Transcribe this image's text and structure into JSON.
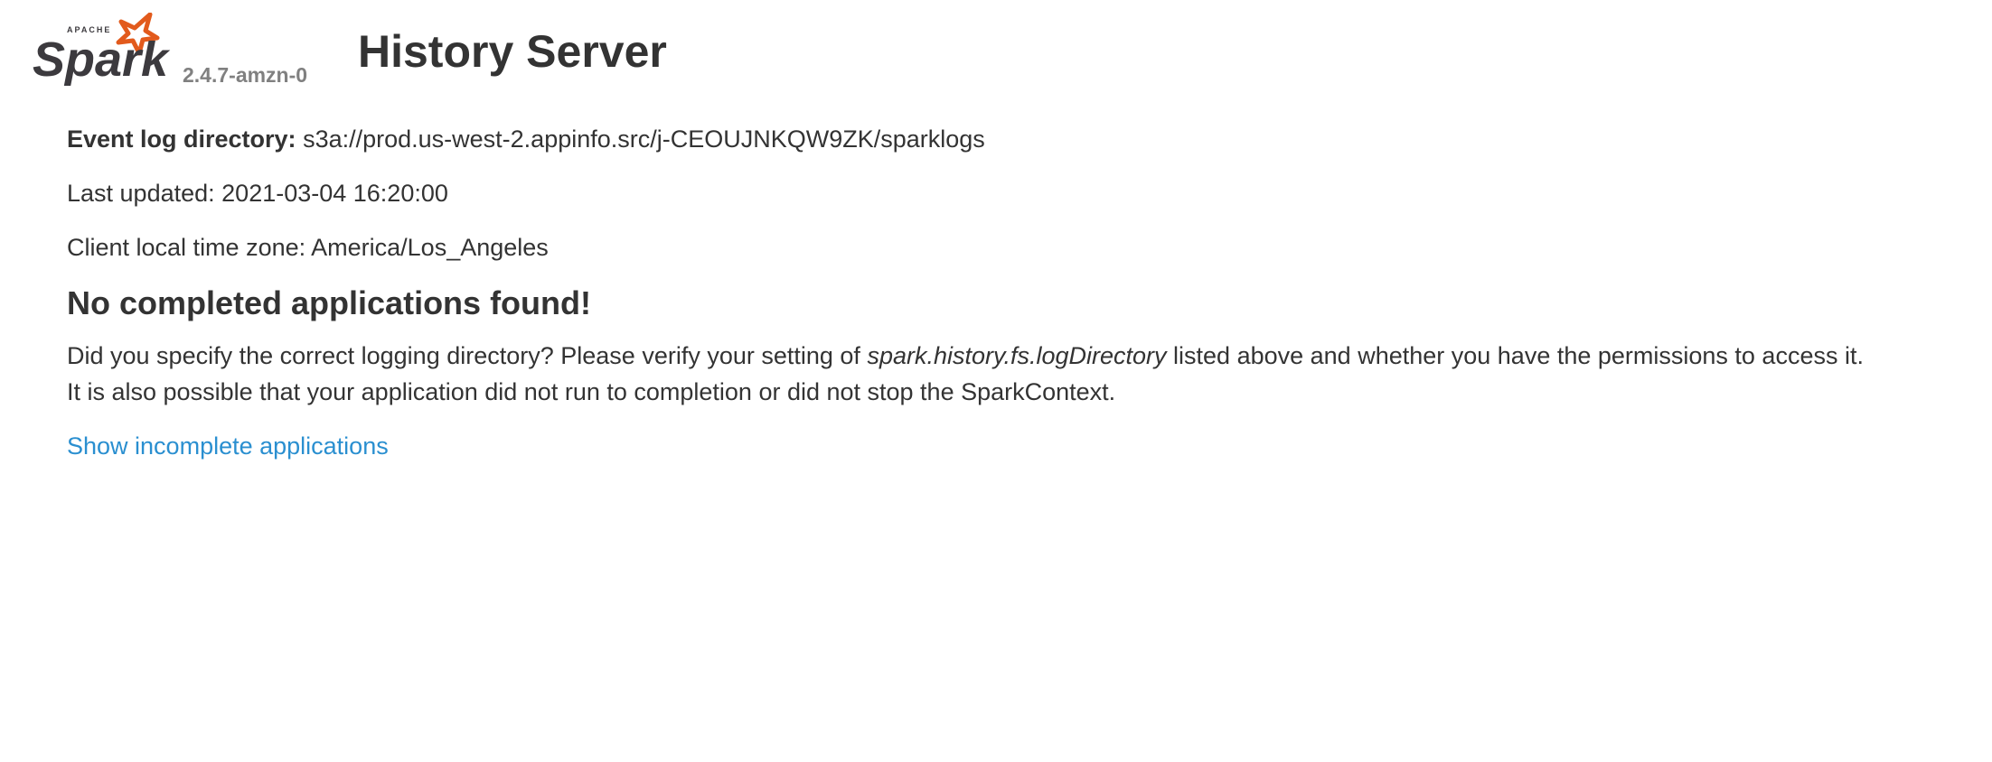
{
  "header": {
    "logo_small_text": "APACHE",
    "logo_word": "Spark",
    "version": "2.4.7-amzn-0",
    "title": "History Server"
  },
  "info": {
    "event_log_label": "Event log directory:",
    "event_log_value": "s3a://prod.us-west-2.appinfo.src/j-CEOUJNKQW9ZK/sparklogs",
    "last_updated_label": "Last updated:",
    "last_updated_value": "2021-03-04 16:20:00",
    "timezone_label": "Client local time zone:",
    "timezone_value": "America/Los_Angeles"
  },
  "empty_state": {
    "heading": "No completed applications found!",
    "message_part1": "Did you specify the correct logging directory? Please verify your setting of",
    "message_setting": "spark.history.fs.logDirectory",
    "message_part2": "listed above and whether you have the permissions to access it.",
    "message_line2": "It is also possible that your application did not run to completion or did not stop the SparkContext."
  },
  "links": {
    "show_incomplete": "Show incomplete applications"
  },
  "colors": {
    "link": "#2a8fd0",
    "logo_star": "#e25a1c",
    "logo_text": "#3c3a3e",
    "version": "#808080",
    "text": "#333333"
  }
}
